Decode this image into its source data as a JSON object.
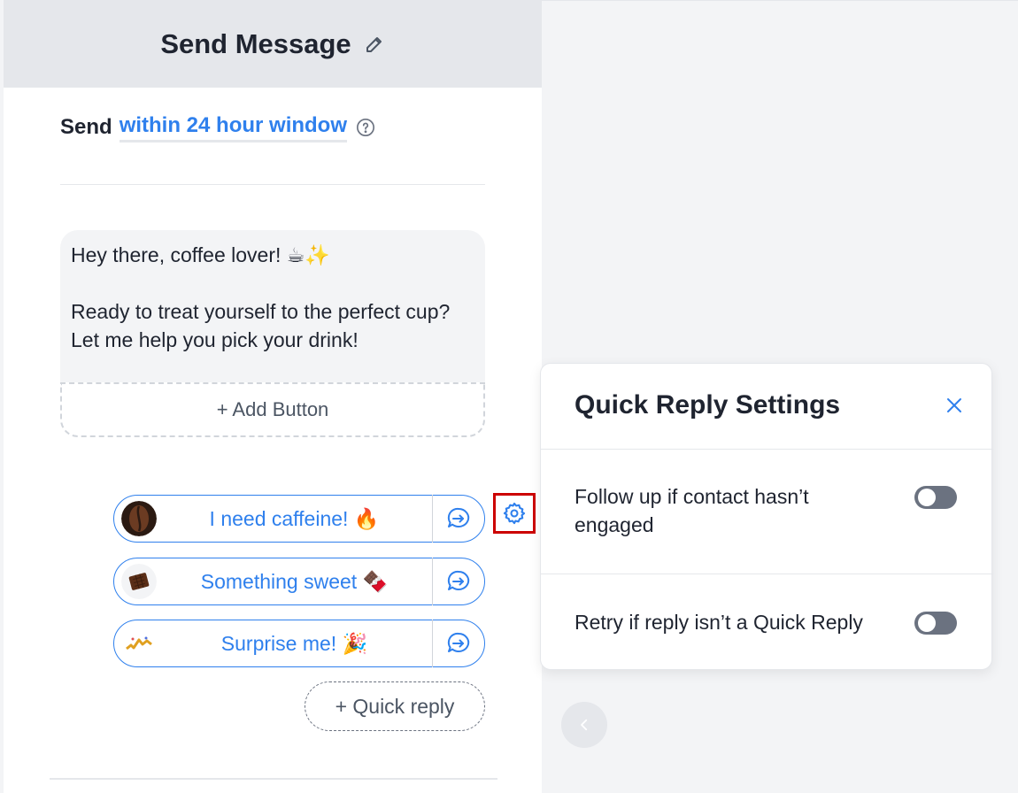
{
  "panel": {
    "title": "Send Message",
    "send_label": "Send",
    "window_link": "within 24 hour window"
  },
  "message": {
    "text": "Hey there, coffee lover! ☕✨\n\nReady to treat yourself to the perfect cup? Let me help you pick your drink!",
    "add_button_label": "+ Add Button"
  },
  "quick_replies": [
    {
      "label": "I need caffeine! 🔥",
      "thumb": "coffee-beans-thumb"
    },
    {
      "label": "Something sweet 🍫",
      "thumb": "chocolate-thumb"
    },
    {
      "label": "Surprise me! 🎉",
      "thumb": "surprise-thumb"
    }
  ],
  "add_quick_reply_label": "+ Quick reply",
  "settings": {
    "title": "Quick Reply Settings",
    "options": [
      {
        "label": "Follow up if contact hasn’t engaged",
        "enabled": false
      },
      {
        "label": "Retry if reply isn’t a Quick Reply",
        "enabled": false
      }
    ]
  },
  "colors": {
    "accent": "#2f80ed",
    "highlight": "#cc0000",
    "toggle_off": "#6b7280"
  },
  "icons": [
    "pencil-icon",
    "help-circle-icon",
    "reply-arrow-icon",
    "gear-icon",
    "close-icon",
    "chevron-left-icon"
  ]
}
